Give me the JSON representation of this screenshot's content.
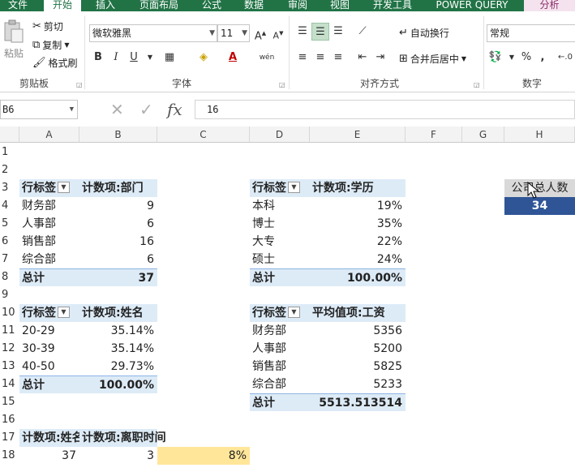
{
  "ribbon": {
    "tabs": [
      "文件",
      "开始",
      "插入",
      "页面布局",
      "公式",
      "数据",
      "审阅",
      "视图",
      "开发工具",
      "POWER QUERY",
      "分析"
    ],
    "clipboard": {
      "paste": "粘贴",
      "cut": "剪切",
      "copy": "复制",
      "format_painter": "格式刷",
      "label": "剪贴板"
    },
    "font": {
      "name": "微软雅黑",
      "size": "11",
      "label": "字体",
      "bold": "B",
      "italic": "I",
      "underline": "U",
      "grow": "A",
      "shrink": "A",
      "phonetic": "wén"
    },
    "alignment": {
      "wrap": "自动换行",
      "merge": "合并后居中",
      "label": "对齐方式"
    },
    "number": {
      "format": "常规",
      "label": "数字",
      "percent": "%",
      "comma": ","
    }
  },
  "formula_bar": {
    "name_box": "B6",
    "cancel": "✕",
    "enter": "✓",
    "fx": "fx",
    "value": "16"
  },
  "columns": [
    "A",
    "B",
    "C",
    "D",
    "E",
    "F",
    "G",
    "H"
  ],
  "rows": [
    "1",
    "2",
    "3",
    "4",
    "5",
    "6",
    "7",
    "8",
    "9",
    "10",
    "11",
    "12",
    "13",
    "14",
    "15",
    "16",
    "17",
    "18"
  ],
  "pivots": {
    "dept": {
      "row_label": "行标签",
      "value_label": "计数项:部门",
      "rows": [
        {
          "k": "财务部",
          "v": "9"
        },
        {
          "k": "人事部",
          "v": "6"
        },
        {
          "k": "销售部",
          "v": "16"
        },
        {
          "k": "综合部",
          "v": "6"
        }
      ],
      "total_label": "总计",
      "total": "37"
    },
    "edu": {
      "row_label": "行标签",
      "value_label": "计数项:学历",
      "rows": [
        {
          "k": "本科",
          "v": "19%"
        },
        {
          "k": "博士",
          "v": "35%"
        },
        {
          "k": "大专",
          "v": "22%"
        },
        {
          "k": "硕士",
          "v": "24%"
        }
      ],
      "total_label": "总计",
      "total": "100.00%"
    },
    "age": {
      "row_label": "行标签",
      "value_label": "计数项:姓名",
      "rows": [
        {
          "k": "20-29",
          "v": "35.14%"
        },
        {
          "k": "30-39",
          "v": "35.14%"
        },
        {
          "k": "40-50",
          "v": "29.73%"
        }
      ],
      "total_label": "总计",
      "total": "100.00%"
    },
    "salary": {
      "row_label": "行标签",
      "value_label": "平均值项:工资",
      "rows": [
        {
          "k": "财务部",
          "v": "5356"
        },
        {
          "k": "人事部",
          "v": "5200"
        },
        {
          "k": "销售部",
          "v": "5825"
        },
        {
          "k": "综合部",
          "v": "5233"
        }
      ],
      "total_label": "总计",
      "total": "5513.513514"
    },
    "leave": {
      "h1": "计数项:姓名",
      "h2": "计数项:离职时间",
      "v1": "37",
      "v2": "3",
      "rate": "8%"
    }
  },
  "kpi": {
    "label": "公司总人数",
    "value": "34"
  },
  "colors": {
    "excel_green": "#217346",
    "pivot_header": "#ddebf7",
    "kpi_blue": "#2f5597",
    "highlight": "#ffe699"
  }
}
